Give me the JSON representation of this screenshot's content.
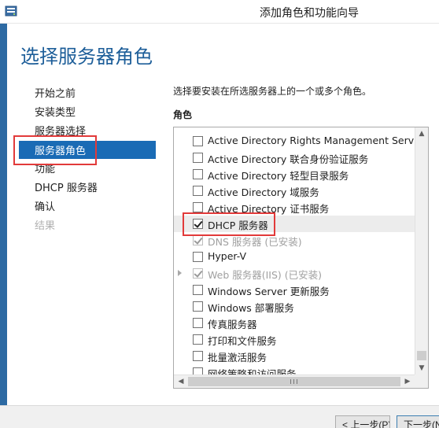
{
  "window": {
    "title": "添加角色和功能向导"
  },
  "page": {
    "title": "选择服务器角色"
  },
  "nav": {
    "items": [
      {
        "label": "开始之前",
        "state": "normal"
      },
      {
        "label": "安装类型",
        "state": "normal"
      },
      {
        "label": "服务器选择",
        "state": "normal"
      },
      {
        "label": "服务器角色",
        "state": "active"
      },
      {
        "label": "功能",
        "state": "normal"
      },
      {
        "label": "DHCP 服务器",
        "state": "normal"
      },
      {
        "label": "确认",
        "state": "normal"
      },
      {
        "label": "结果",
        "state": "disabled"
      }
    ]
  },
  "main": {
    "description": "选择要安装在所选服务器上的一个或多个角色。",
    "roles_label": "角色",
    "roles": [
      {
        "label": "Active Directory Rights Management Services",
        "checked": false,
        "disabled": false
      },
      {
        "label": "Active Directory 联合身份验证服务",
        "checked": false,
        "disabled": false
      },
      {
        "label": "Active Directory 轻型目录服务",
        "checked": false,
        "disabled": false
      },
      {
        "label": "Active Directory 域服务",
        "checked": false,
        "disabled": false
      },
      {
        "label": "Active Directory 证书服务",
        "checked": false,
        "disabled": false
      },
      {
        "label": "DHCP 服务器",
        "checked": true,
        "disabled": false,
        "selected": true
      },
      {
        "label": "DNS 服务器 (已安装)",
        "checked": true,
        "disabled": true
      },
      {
        "label": "Hyper-V",
        "checked": false,
        "disabled": false
      },
      {
        "label": "Web 服务器(IIS) (已安装)",
        "checked": true,
        "disabled": true,
        "expandable": true
      },
      {
        "label": "Windows Server 更新服务",
        "checked": false,
        "disabled": false
      },
      {
        "label": "Windows 部署服务",
        "checked": false,
        "disabled": false
      },
      {
        "label": "传真服务器",
        "checked": false,
        "disabled": false
      },
      {
        "label": "打印和文件服务",
        "checked": false,
        "disabled": false
      },
      {
        "label": "批量激活服务",
        "checked": false,
        "disabled": false
      },
      {
        "label": "网络策略和访问服务",
        "checked": false,
        "disabled": false
      }
    ]
  },
  "footer": {
    "prev_label": "< 上一步(P)",
    "next_label": "下一步(N) >"
  },
  "colors": {
    "accent": "#1a6bb5",
    "title": "#1d5e99",
    "highlight": "#e23a3a",
    "frame": "#2d6aa3"
  }
}
